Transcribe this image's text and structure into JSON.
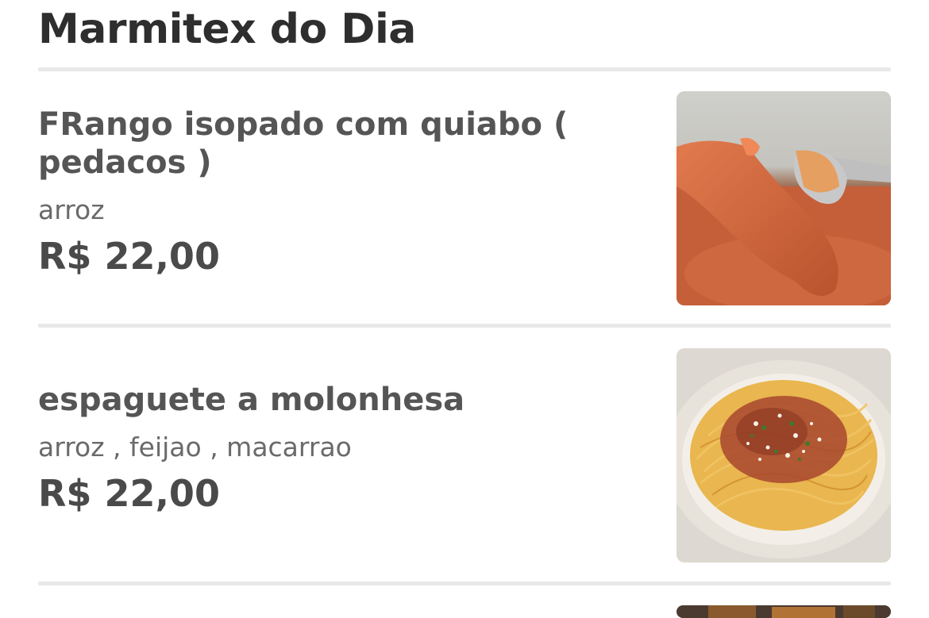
{
  "section": {
    "title": "Marmitex do Dia"
  },
  "items": [
    {
      "name": "FRango isopado com quiabo ( pedacos )",
      "description": "arroz",
      "price": "R$ 22,00",
      "image_icon": "chicken-stew-photo"
    },
    {
      "name": "espaguete a molonhesa",
      "description": "arroz , feijao , macarrao",
      "price": "R$ 22,00",
      "image_icon": "spaghetti-bolognese-photo"
    }
  ],
  "colors": {
    "title": "#2e2e2e",
    "name": "#555555",
    "description": "#6a6a6a",
    "divider": "#e8e8e8"
  }
}
